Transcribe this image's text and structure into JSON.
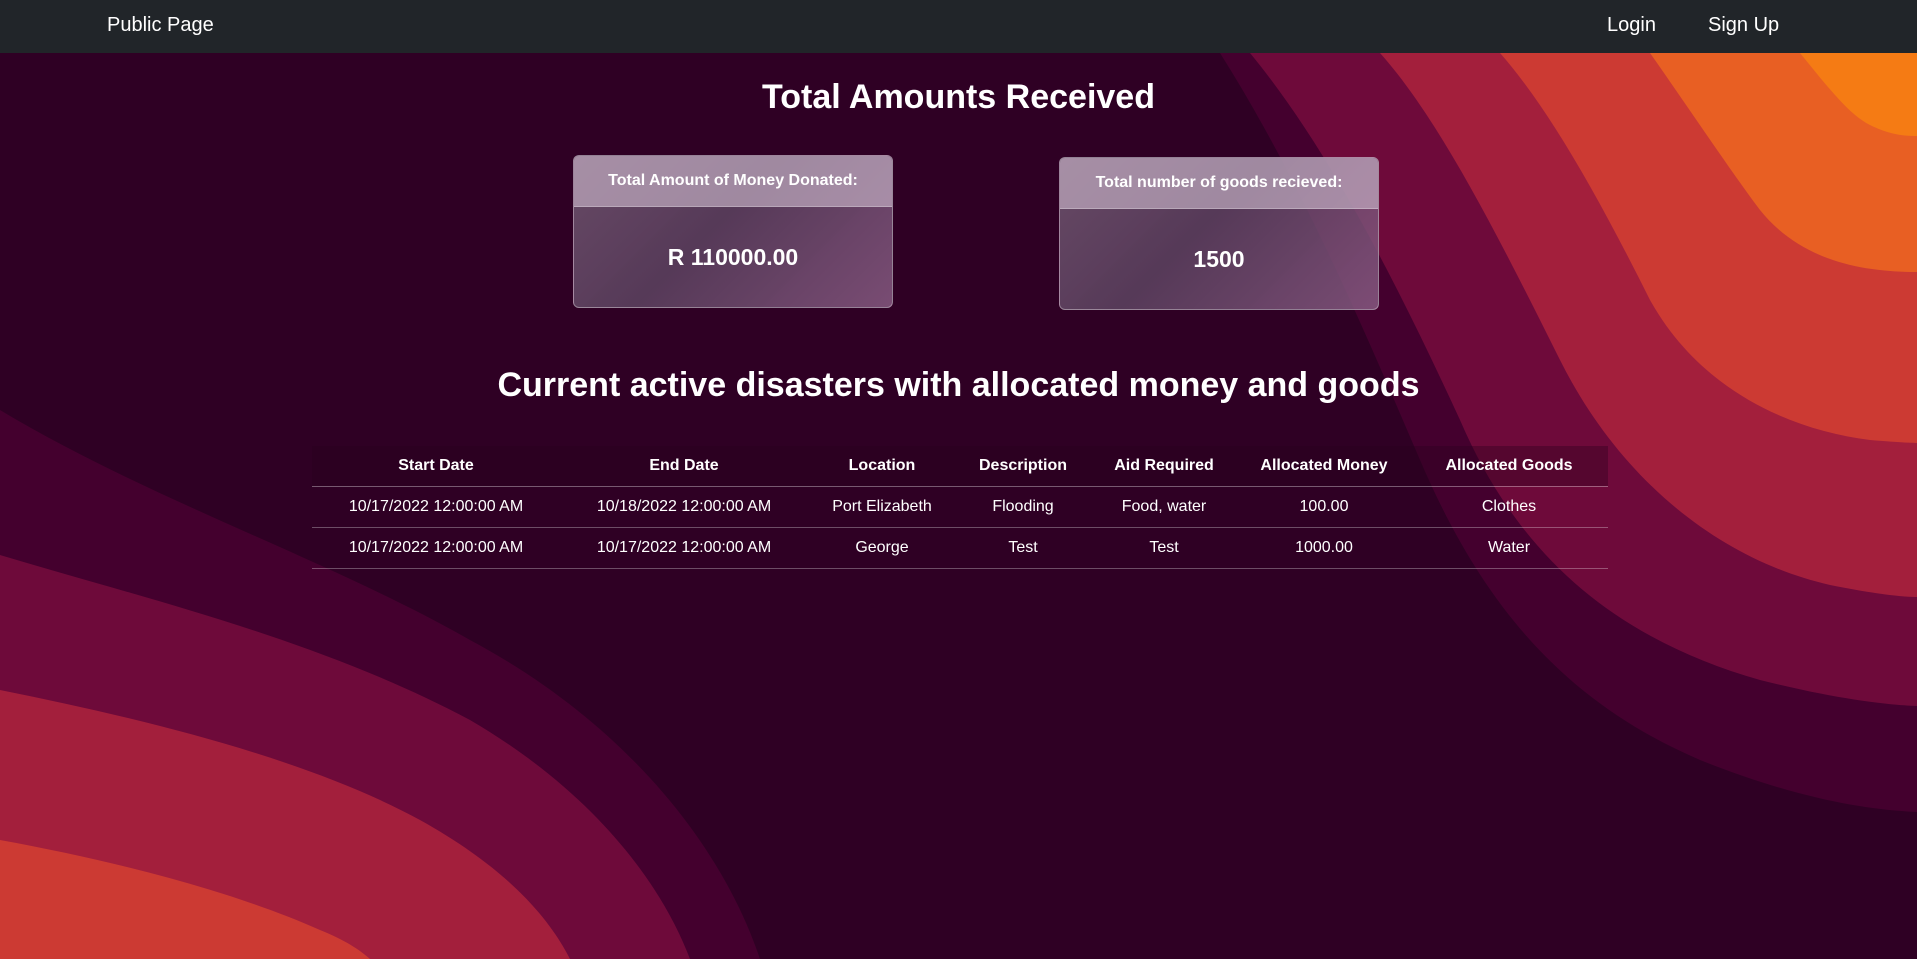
{
  "navbar": {
    "brand": "Public Page",
    "login_label": "Login",
    "signup_label": "Sign Up"
  },
  "totals": {
    "title": "Total Amounts Received",
    "money_card": {
      "header": "Total Amount of Money Donated:",
      "value": "R 110000.00"
    },
    "goods_card": {
      "header": "Total number of goods recieved:",
      "value": "1500"
    }
  },
  "disasters": {
    "title": "Current active disasters with allocated money and goods",
    "columns": [
      "Start Date",
      "End Date",
      "Location",
      "Description",
      "Aid Required",
      "Allocated Money",
      "Allocated Goods"
    ],
    "rows": [
      [
        "10/17/2022 12:00:00 AM",
        "10/18/2022 12:00:00 AM",
        "Port Elizabeth",
        "Flooding",
        "Food, water",
        "100.00",
        "Clothes"
      ],
      [
        "10/17/2022 12:00:00 AM",
        "10/17/2022 12:00:00 AM",
        "George",
        "Test",
        "Test",
        "1000.00",
        "Water"
      ]
    ]
  },
  "colors": {
    "navbar_bg": "#212529",
    "page_bg": "#2f0024",
    "wave_dark": "#44002e",
    "wave_mid": "#6e0a3a",
    "wave_red": "#a31f3c",
    "wave_orange_red": "#cc3a33",
    "wave_orange": "#e85f23",
    "wave_bright_orange": "#f57b14"
  }
}
